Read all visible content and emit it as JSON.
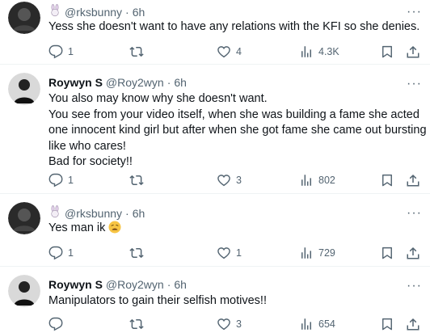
{
  "tweets": [
    {
      "name": "",
      "name_icon": "bunny-icon",
      "handle": "@rksbunny",
      "dot": "·",
      "time": "6h",
      "lines": [
        "Yess she doesn't want to have any relations with the KFI so she denies."
      ],
      "replies": "1",
      "reposts": "",
      "likes": "4",
      "views": "4.3K"
    },
    {
      "name": "Roywyn S",
      "handle": "@Roy2wyn",
      "dot": "·",
      "time": "6h",
      "lines": [
        "You also may know why she doesn't want.",
        "You see from your video itself, when she was building a fame she acted",
        "one innocent kind girl but after when she got fame she came out bursting",
        "like who cares!",
        "Bad for society!!"
      ],
      "replies": "1",
      "reposts": "",
      "likes": "3",
      "views": "802"
    },
    {
      "name": "",
      "name_icon": "bunny-icon",
      "handle": "@rksbunny",
      "dot": "·",
      "time": "6h",
      "lines": [
        "Yes man ik"
      ],
      "emoji": "weary-face-emoji",
      "replies": "1",
      "reposts": "",
      "likes": "1",
      "views": "729"
    },
    {
      "name": "Roywyn S",
      "handle": "@Roy2wyn",
      "dot": "·",
      "time": "6h",
      "lines": [
        "Manipulators to gain their selfish motives!!"
      ],
      "replies": "",
      "reposts": "",
      "likes": "3",
      "views": "654"
    }
  ],
  "more_glyph": "···"
}
